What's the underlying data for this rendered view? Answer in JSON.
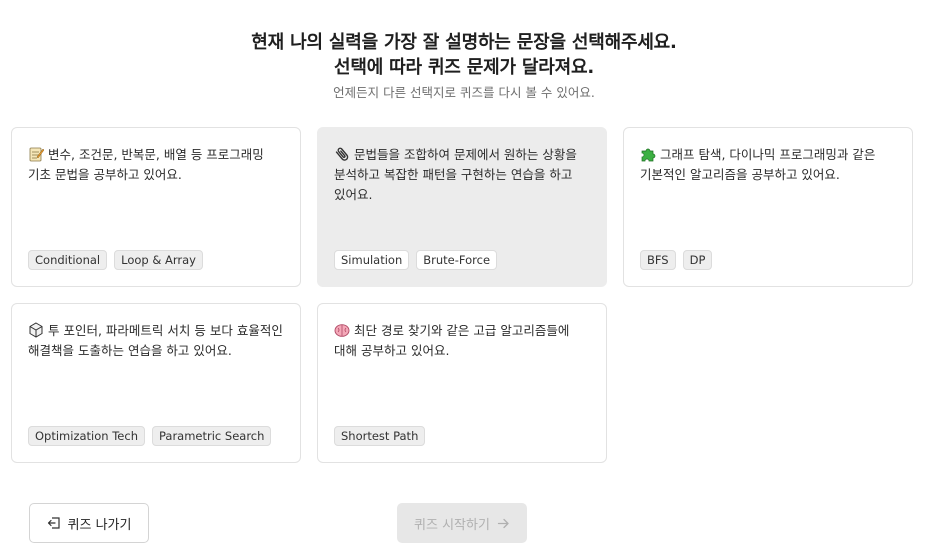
{
  "header": {
    "title_line1": "현재 나의 실력을 가장 잘 설명하는 문장을 선택해주세요.",
    "title_line2": "선택에 따라 퀴즈 문제가 달라져요.",
    "subtitle": "언제든지 다른 선택지로 퀴즈를 다시 볼 수 있어요."
  },
  "cards": [
    {
      "icon": "memo-icon",
      "description": "변수, 조건문, 반복문, 배열 등 프로그래밍 기초 문법을 공부하고 있어요.",
      "tags": [
        "Conditional",
        "Loop & Array"
      ],
      "selected": false
    },
    {
      "icon": "paperclip-icon",
      "description": "문법들을 조합하여 문제에서 원하는 상황을 분석하고 복잡한 패턴을 구현하는 연습을 하고 있어요.",
      "tags": [
        "Simulation",
        "Brute-Force"
      ],
      "selected": true
    },
    {
      "icon": "puzzle-icon",
      "description": "그래프 탐색, 다이나믹 프로그래밍과 같은 기본적인 알고리즘을 공부하고 있어요.",
      "tags": [
        "BFS",
        "DP"
      ],
      "selected": false
    },
    {
      "icon": "cube-icon",
      "description": "투 포인터, 파라메트릭 서치 등 보다 효율적인 해결책을 도출하는 연습을 하고 있어요.",
      "tags": [
        "Optimization Tech",
        "Parametric Search"
      ],
      "selected": false
    },
    {
      "icon": "brain-icon",
      "description": "최단 경로 찾기와 같은 고급 알고리즘들에 대해 공부하고 있어요.",
      "tags": [
        "Shortest Path"
      ],
      "selected": false
    }
  ],
  "buttons": {
    "exit_label": "퀴즈 나가기",
    "exit_icon": "exit-door-icon",
    "start_label": "퀴즈 시작하기",
    "start_icon": "arrow-right-icon",
    "start_enabled": false
  }
}
